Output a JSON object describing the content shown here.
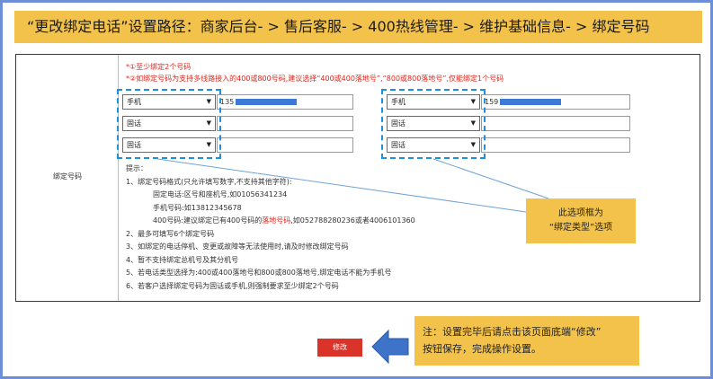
{
  "banner": {
    "text": "“更改绑定电话”设置路径：商家后台- > 售后客服- > 400热线管理- > 维护基础信息- > 绑定号码"
  },
  "form": {
    "field_label": "绑定号码",
    "hint1": "*①至少绑定2个号码",
    "hint2": "*②如绑定号码为支持多线路接入的400或800号码,建议选择“400或400落地号”,“800或800落地号”,仅能绑定1个号码",
    "left_rows": [
      {
        "type": "手机",
        "value": "135"
      },
      {
        "type": "固话",
        "value": ""
      },
      {
        "type": "固话",
        "value": ""
      }
    ],
    "right_rows": [
      {
        "type": "手机",
        "value": "159"
      },
      {
        "type": "固话",
        "value": ""
      },
      {
        "type": "固话",
        "value": ""
      }
    ],
    "tips": {
      "title": "提示：",
      "l1": "1、绑定号码格式(只允许填写数字,不支持其他字符):",
      "l1a": "固定电话:区号和座机号,如01056341234",
      "l1b": "手机号码:如13812345678",
      "l1c_pre": "400号码:建议绑定已有400号码的",
      "l1c_red": "落地号码",
      "l1c_post": ",如052788280236或者4006101360",
      "l2": "2、最多可填写6个绑定号码",
      "l3": "3、如绑定的电话停机、变更或故障等无法使用时,请及时修改绑定号码",
      "l4": "4、暂不支持绑定总机号及其分机号",
      "l5": "5、若电话类型选择为:400或400落地号和800或800落地号,绑定电话不能为手机号",
      "l6": "6、若客户选择绑定号码为固话或手机,则强制要求至少绑定2个号码"
    }
  },
  "callout": {
    "line1": "此选项框为",
    "line2": "“绑定类型”选项"
  },
  "note": {
    "line1": "注：设置完毕后请点击该页面底端“修改”",
    "line2": "按钮保存，完成操作设置。"
  },
  "submit_label": "修改",
  "colors": {
    "banner": "#f2c24a",
    "dash": "#1e8fdc",
    "hint_red": "#e1251b",
    "button": "#d9332a",
    "arrow": "#3d73c9"
  }
}
